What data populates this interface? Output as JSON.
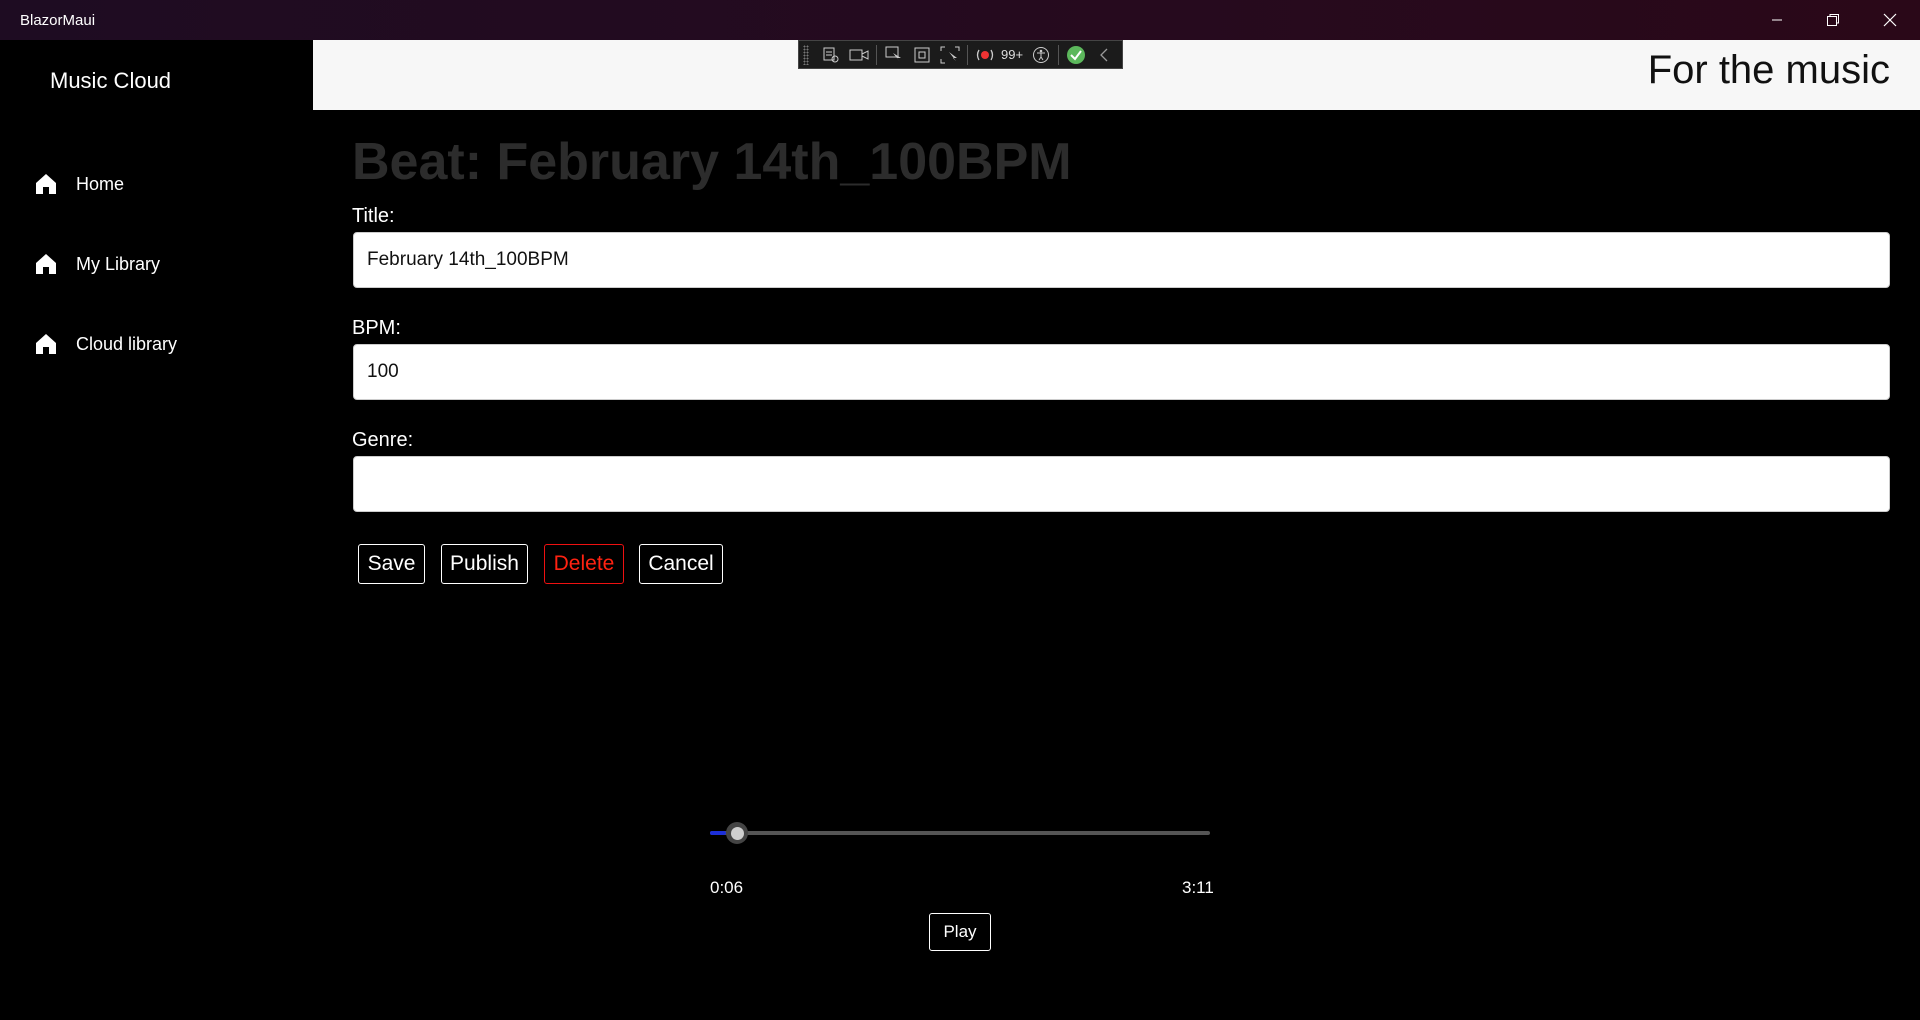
{
  "window": {
    "title": "BlazorMaui",
    "controls": [
      "minimize-icon",
      "restore-icon",
      "close-icon"
    ]
  },
  "sidebar": {
    "brand": "Music Cloud",
    "items": [
      {
        "label": "Home",
        "icon": "home-icon"
      },
      {
        "label": "My Library",
        "icon": "home-icon"
      },
      {
        "label": "Cloud library",
        "icon": "home-icon"
      }
    ]
  },
  "header": {
    "tagline": "For the music"
  },
  "devtools": {
    "notification_count": "99+"
  },
  "main": {
    "page_title": "Beat: February 14th_100BPM",
    "fields": {
      "title": {
        "label": "Title:",
        "value": "February 14th_100BPM"
      },
      "bpm": {
        "label": "BPM:",
        "value": "100"
      },
      "genre": {
        "label": "Genre:",
        "value": ""
      }
    },
    "actions": {
      "save": "Save",
      "publish": "Publish",
      "delete": "Delete",
      "cancel": "Cancel"
    }
  },
  "player": {
    "current_time": "0:06",
    "duration": "3:11",
    "progress_fraction": 0.031,
    "play_label": "Play"
  },
  "colors": {
    "accent": "#1c2fd9",
    "danger": "#ff2222",
    "titlebar": "#260a1e"
  }
}
